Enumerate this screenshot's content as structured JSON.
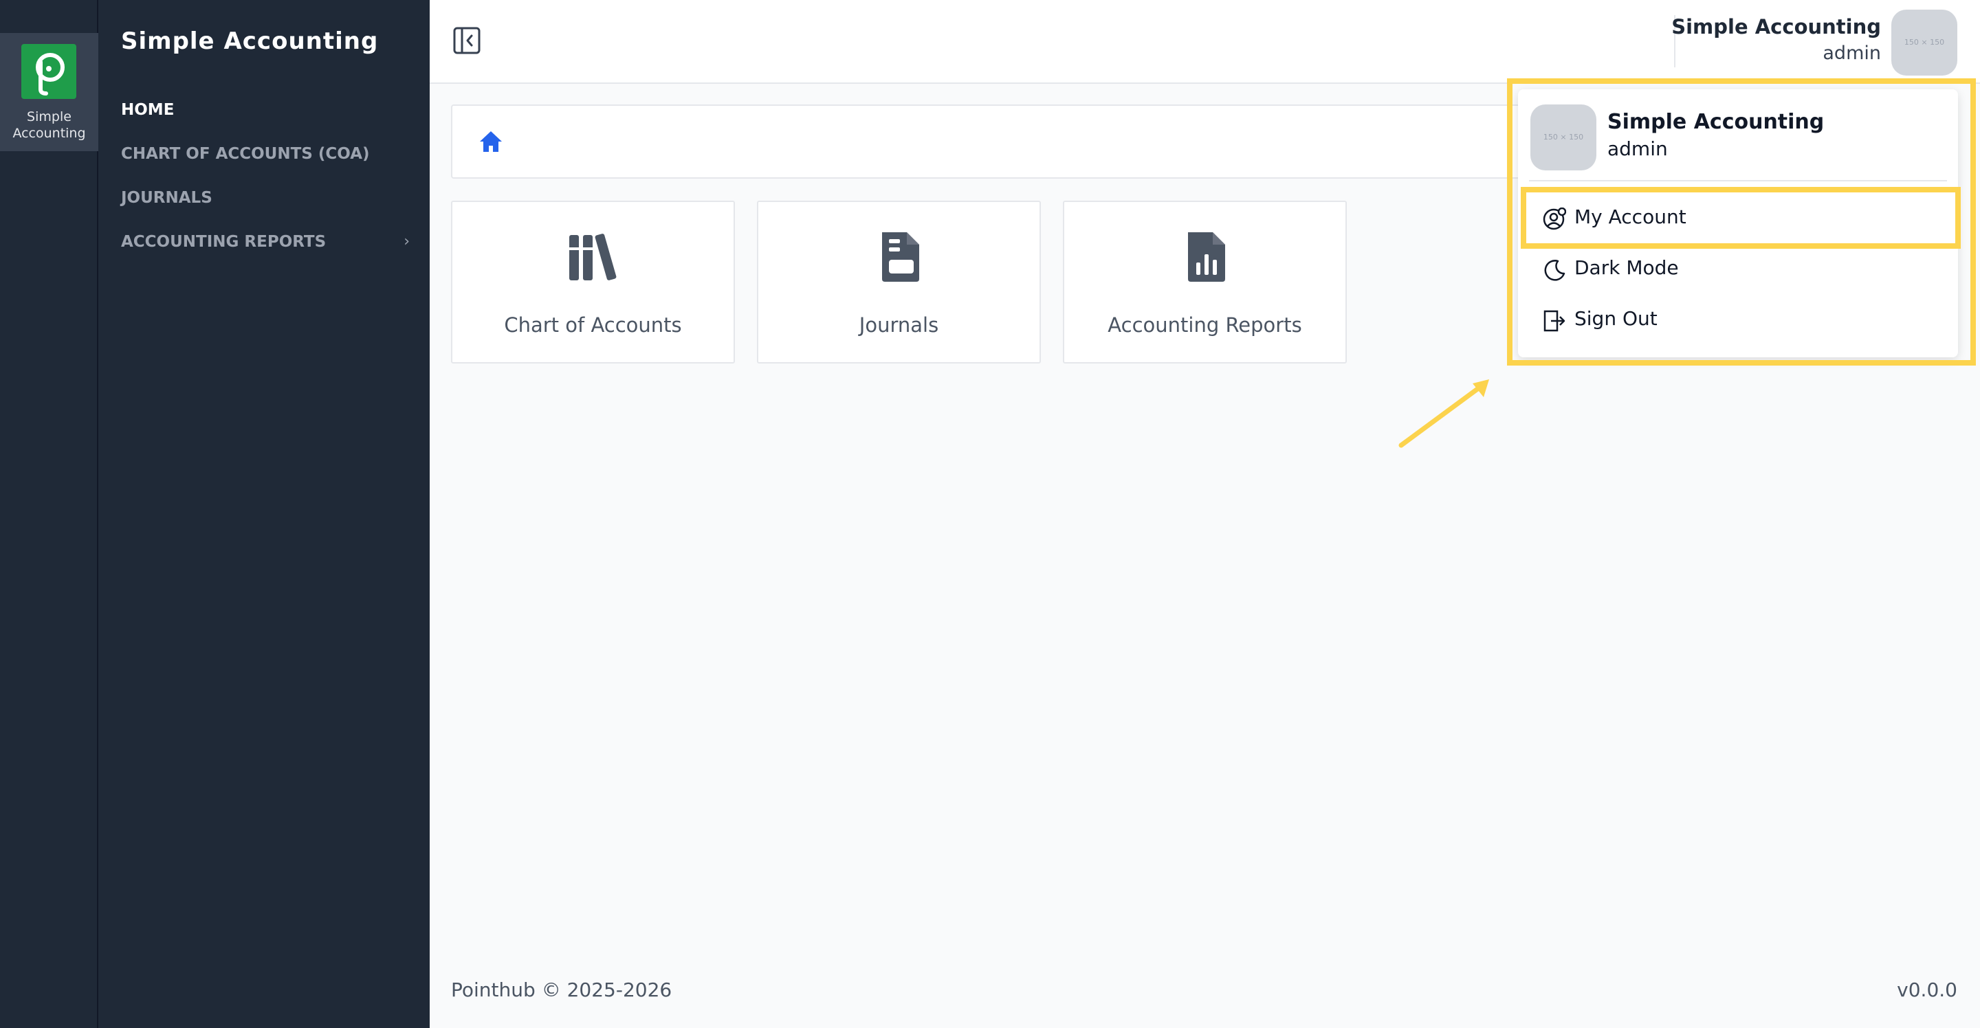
{
  "rail": {
    "app_label_line1": "Simple",
    "app_label_line2": "Accounting"
  },
  "sidebar": {
    "title": "Simple Accounting",
    "items": [
      {
        "label": "HOME"
      },
      {
        "label": "CHART OF ACCOUNTS (COA)"
      },
      {
        "label": "JOURNALS"
      },
      {
        "label": "ACCOUNTING REPORTS"
      }
    ]
  },
  "topbar": {
    "user_name": "Simple Accounting",
    "user_role": "admin",
    "avatar_text": "150 × 150"
  },
  "cards": [
    {
      "label": "Chart of Accounts",
      "icon": "books-icon"
    },
    {
      "label": "Journals",
      "icon": "file-text-icon"
    },
    {
      "label": "Accounting Reports",
      "icon": "file-chart-icon"
    }
  ],
  "dropdown": {
    "name": "Simple Accounting",
    "role": "admin",
    "avatar_text": "150 × 150",
    "items": [
      {
        "label": "My Account",
        "icon": "user-cog-icon"
      },
      {
        "label": "Dark Mode",
        "icon": "moon-icon"
      },
      {
        "label": "Sign Out",
        "icon": "sign-out-icon"
      }
    ]
  },
  "footer": {
    "copyright": "Pointhub © 2025-2026",
    "version": "v0.0.0"
  },
  "colors": {
    "sidebar": "#1f2937",
    "logo": "#1f9d4a",
    "highlight": "#fcd34d",
    "home_icon": "#2563eb"
  }
}
